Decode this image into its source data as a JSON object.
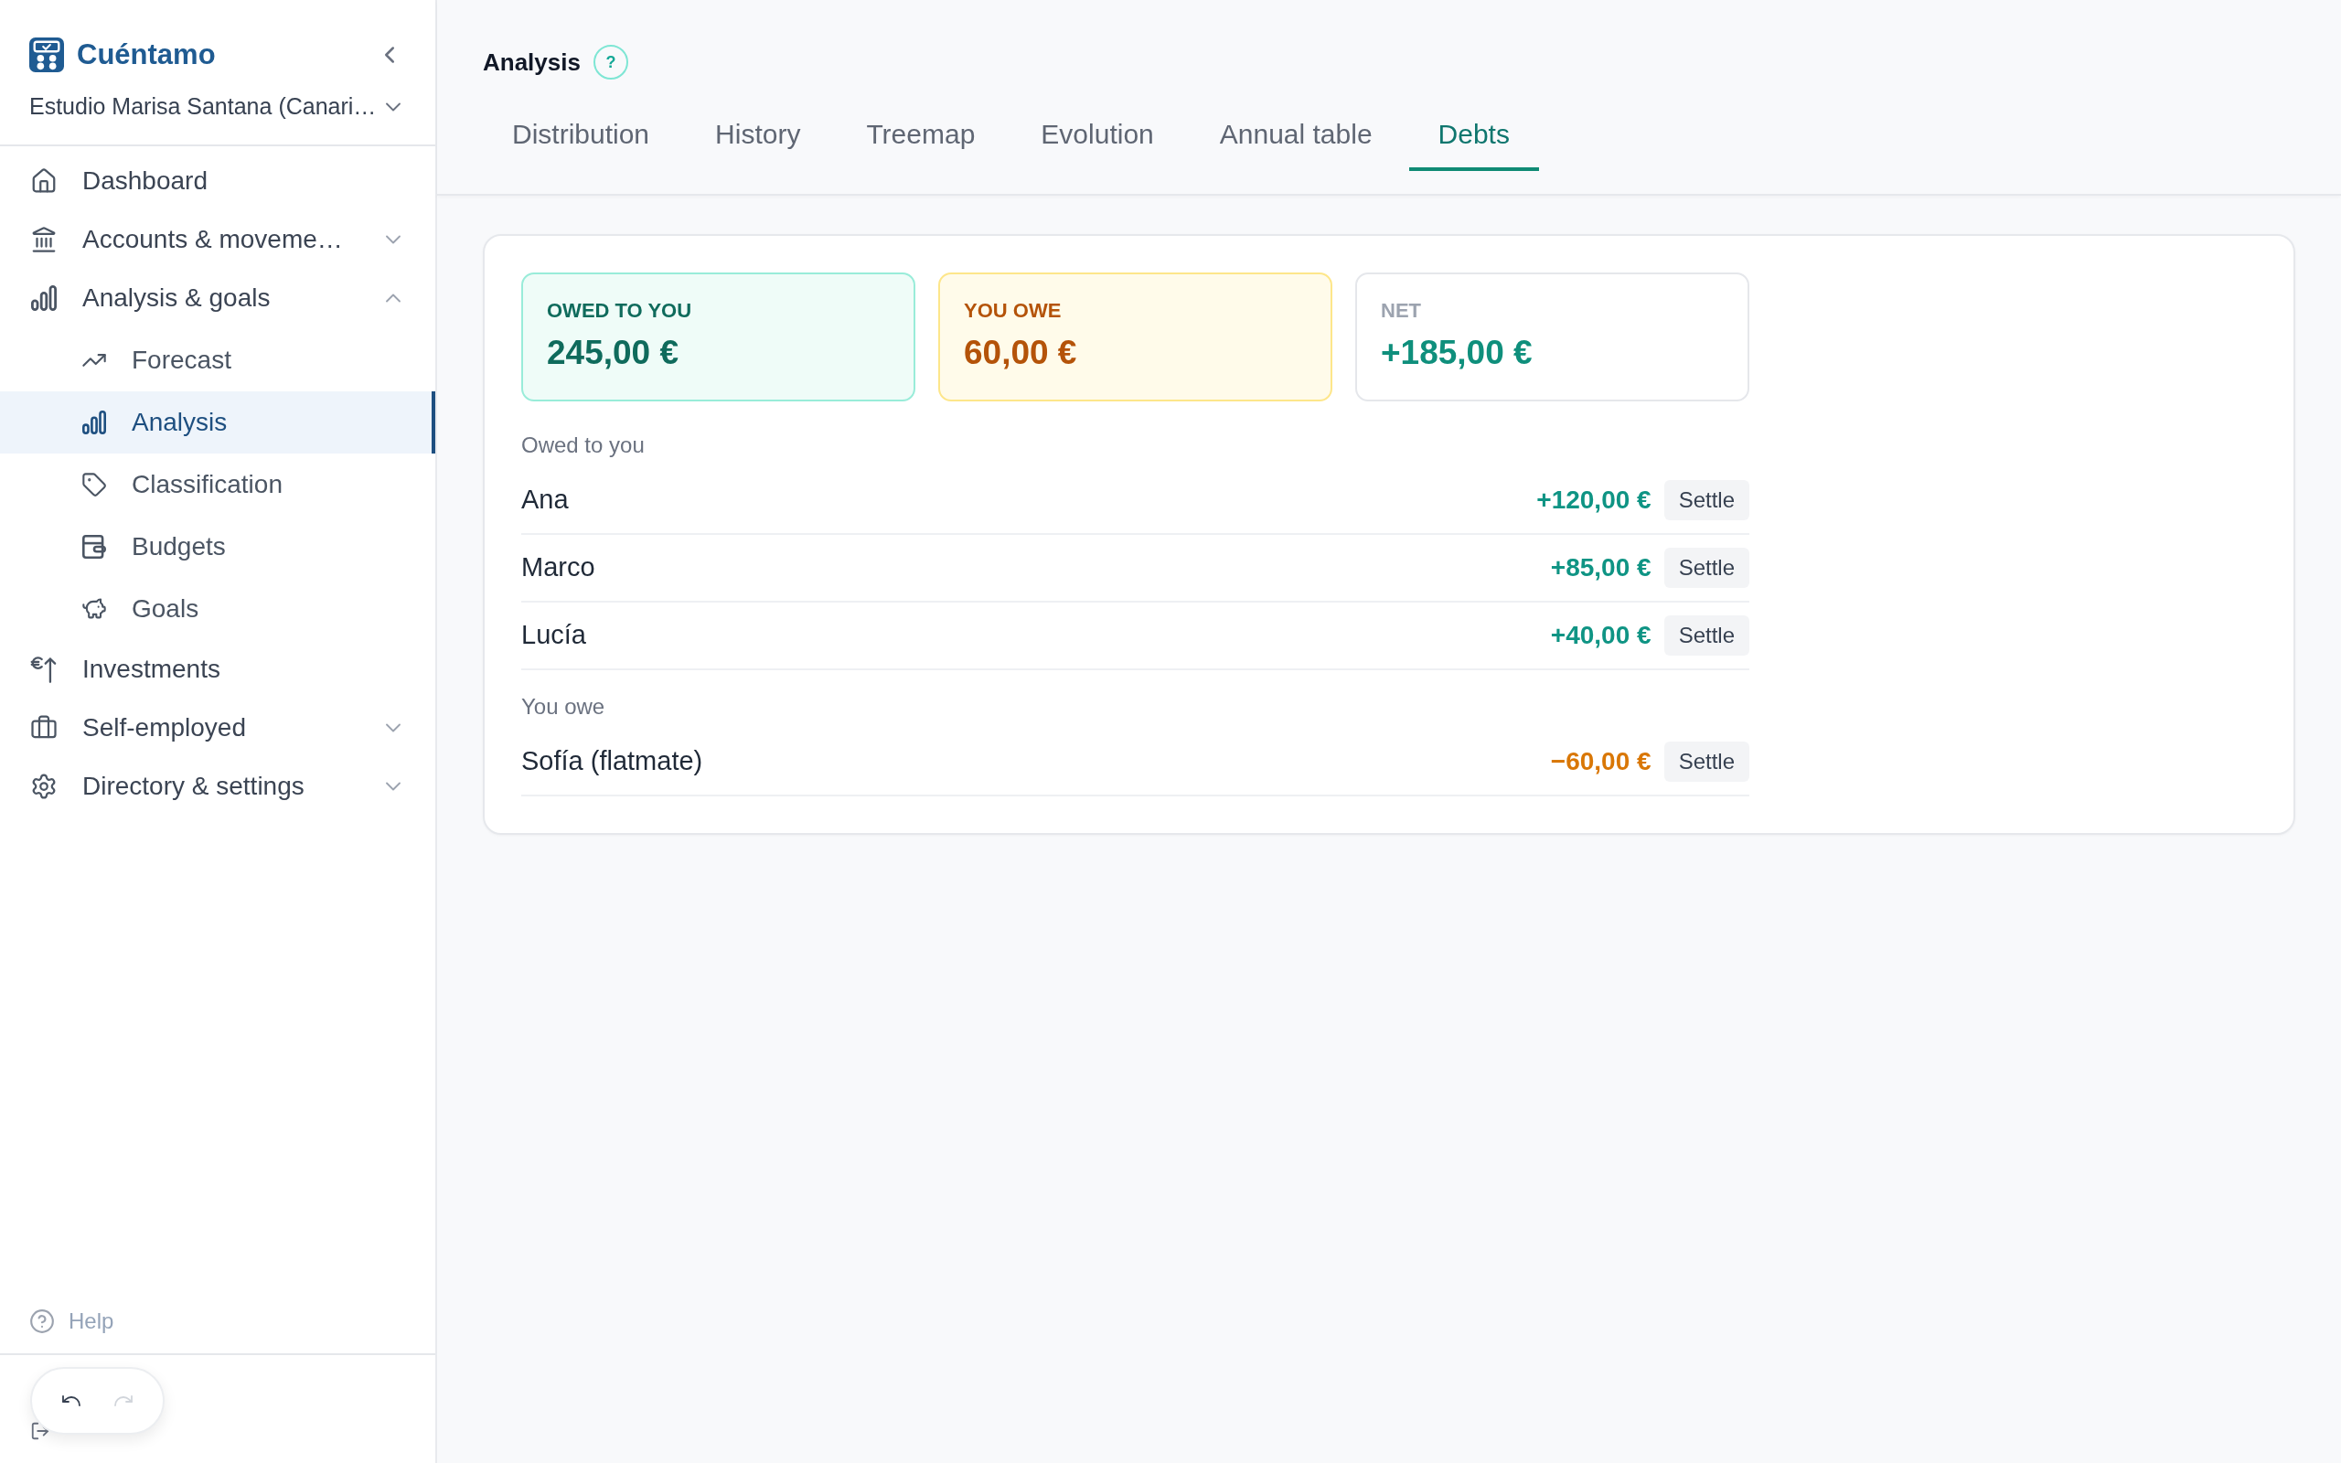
{
  "sidebar": {
    "brand": "Cuéntamo",
    "workspace": "Estudio Marisa Santana (Canari…",
    "items": [
      {
        "label": "Dashboard",
        "selected": false
      },
      {
        "label": "Accounts & moveme…",
        "selected": false,
        "expanded": false
      },
      {
        "label": "Analysis & goals",
        "selected": false,
        "expanded": true,
        "children": [
          {
            "label": "Forecast",
            "selected": false
          },
          {
            "label": "Analysis",
            "selected": true
          },
          {
            "label": "Classification",
            "selected": false
          },
          {
            "label": "Budgets",
            "selected": false
          },
          {
            "label": "Goals",
            "selected": false
          }
        ]
      },
      {
        "label": "Investments",
        "selected": false
      },
      {
        "label": "Self-employed",
        "selected": false,
        "expanded": false
      },
      {
        "label": "Directory & settings",
        "selected": false,
        "expanded": false
      }
    ],
    "help": "Help",
    "history_controls": {
      "undo": {
        "disabled": false
      },
      "redo": {
        "disabled": true
      }
    }
  },
  "page": {
    "title": "Analysis",
    "help_badge": "?",
    "tabs": [
      {
        "label": "Distribution",
        "selected": false
      },
      {
        "label": "History",
        "selected": false
      },
      {
        "label": "Treemap",
        "selected": false
      },
      {
        "label": "Evolution",
        "selected": false
      },
      {
        "label": "Annual table",
        "selected": false
      },
      {
        "label": "Debts",
        "selected": true
      }
    ]
  },
  "debts": {
    "summary": [
      {
        "kind": "credit",
        "label": "OWED TO YOU",
        "value": "245,00 €"
      },
      {
        "kind": "debt",
        "label": "YOU OWE",
        "value": "60,00 €"
      },
      {
        "kind": "net",
        "label": "NET",
        "value": "+185,00 €"
      }
    ],
    "sections": [
      {
        "title": "Owed to you",
        "rows": [
          {
            "name": "Ana",
            "amount": "+120,00 €",
            "kind": "credit",
            "action": "Settle"
          },
          {
            "name": "Marco",
            "amount": "+85,00 €",
            "kind": "credit",
            "action": "Settle"
          },
          {
            "name": "Lucía",
            "amount": "+40,00 €",
            "kind": "credit",
            "action": "Settle"
          }
        ]
      },
      {
        "title": "You owe",
        "rows": [
          {
            "name": "Sofía (flatmate)",
            "amount": "−60,00 €",
            "kind": "debt",
            "action": "Settle"
          }
        ]
      }
    ]
  }
}
